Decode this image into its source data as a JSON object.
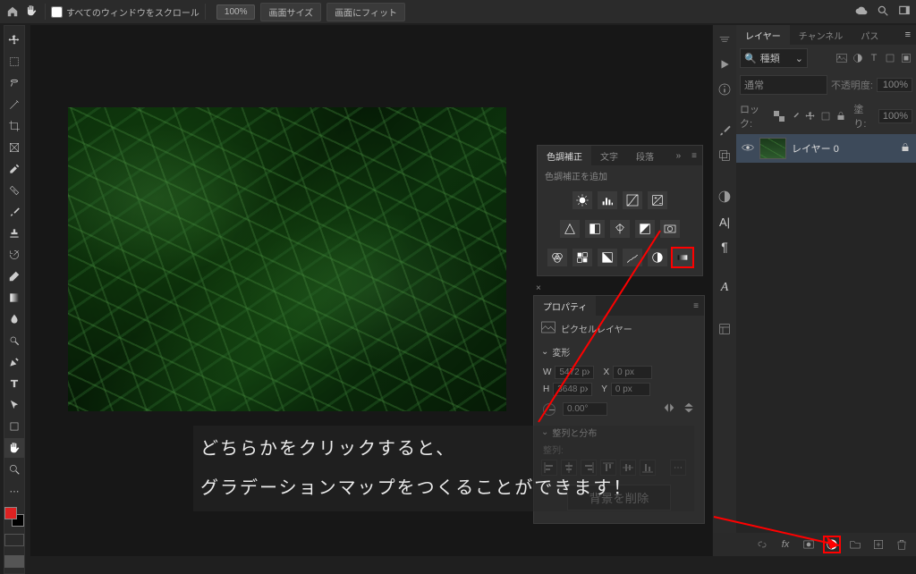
{
  "topbar": {
    "scroll_all_label": "すべてのウィンドウをスクロール",
    "zoom": "100%",
    "btn_actual": "画面サイズ",
    "btn_fit": "画面にフィット"
  },
  "adjustments_panel": {
    "tab_adjust": "色調補正",
    "tab_char": "文字",
    "tab_para": "段落",
    "subtitle": "色調補正を追加",
    "icons": [
      "brightness",
      "levels",
      "curves",
      "exposure",
      "vibrance",
      "huesat",
      "colorbalance",
      "bw",
      "photo-filter",
      "channel-mixer",
      "color-lookup",
      "invert",
      "posterize",
      "threshold",
      "gradient-map",
      "selective-color"
    ]
  },
  "properties_panel": {
    "title": "プロパティ",
    "layer_type": "ピクセルレイヤー",
    "section_transform": "変形",
    "W_label": "W",
    "W_val": "5472 px",
    "X_label": "X",
    "X_val": "0 px",
    "H_label": "H",
    "H_val": "3648 px",
    "Y_label": "Y",
    "Y_val": "0 px",
    "angle_val": "0.00°",
    "section_align": "整列と分布",
    "align_label": "整列:",
    "delete_bg": "背景を削除"
  },
  "layers_panel": {
    "tab_layers": "レイヤー",
    "tab_channels": "チャンネル",
    "tab_paths": "パス",
    "search_kind": "種類",
    "blend_mode": "通常",
    "opacity_label": "不透明度:",
    "opacity_val": "100%",
    "lock_label": "ロック:",
    "fill_label": "塗り:",
    "fill_val": "100%",
    "layer0": "レイヤー 0"
  },
  "caption": {
    "line1": "どちらかをクリックすると、",
    "line2": "グラデーションマップをつくることができます！"
  }
}
